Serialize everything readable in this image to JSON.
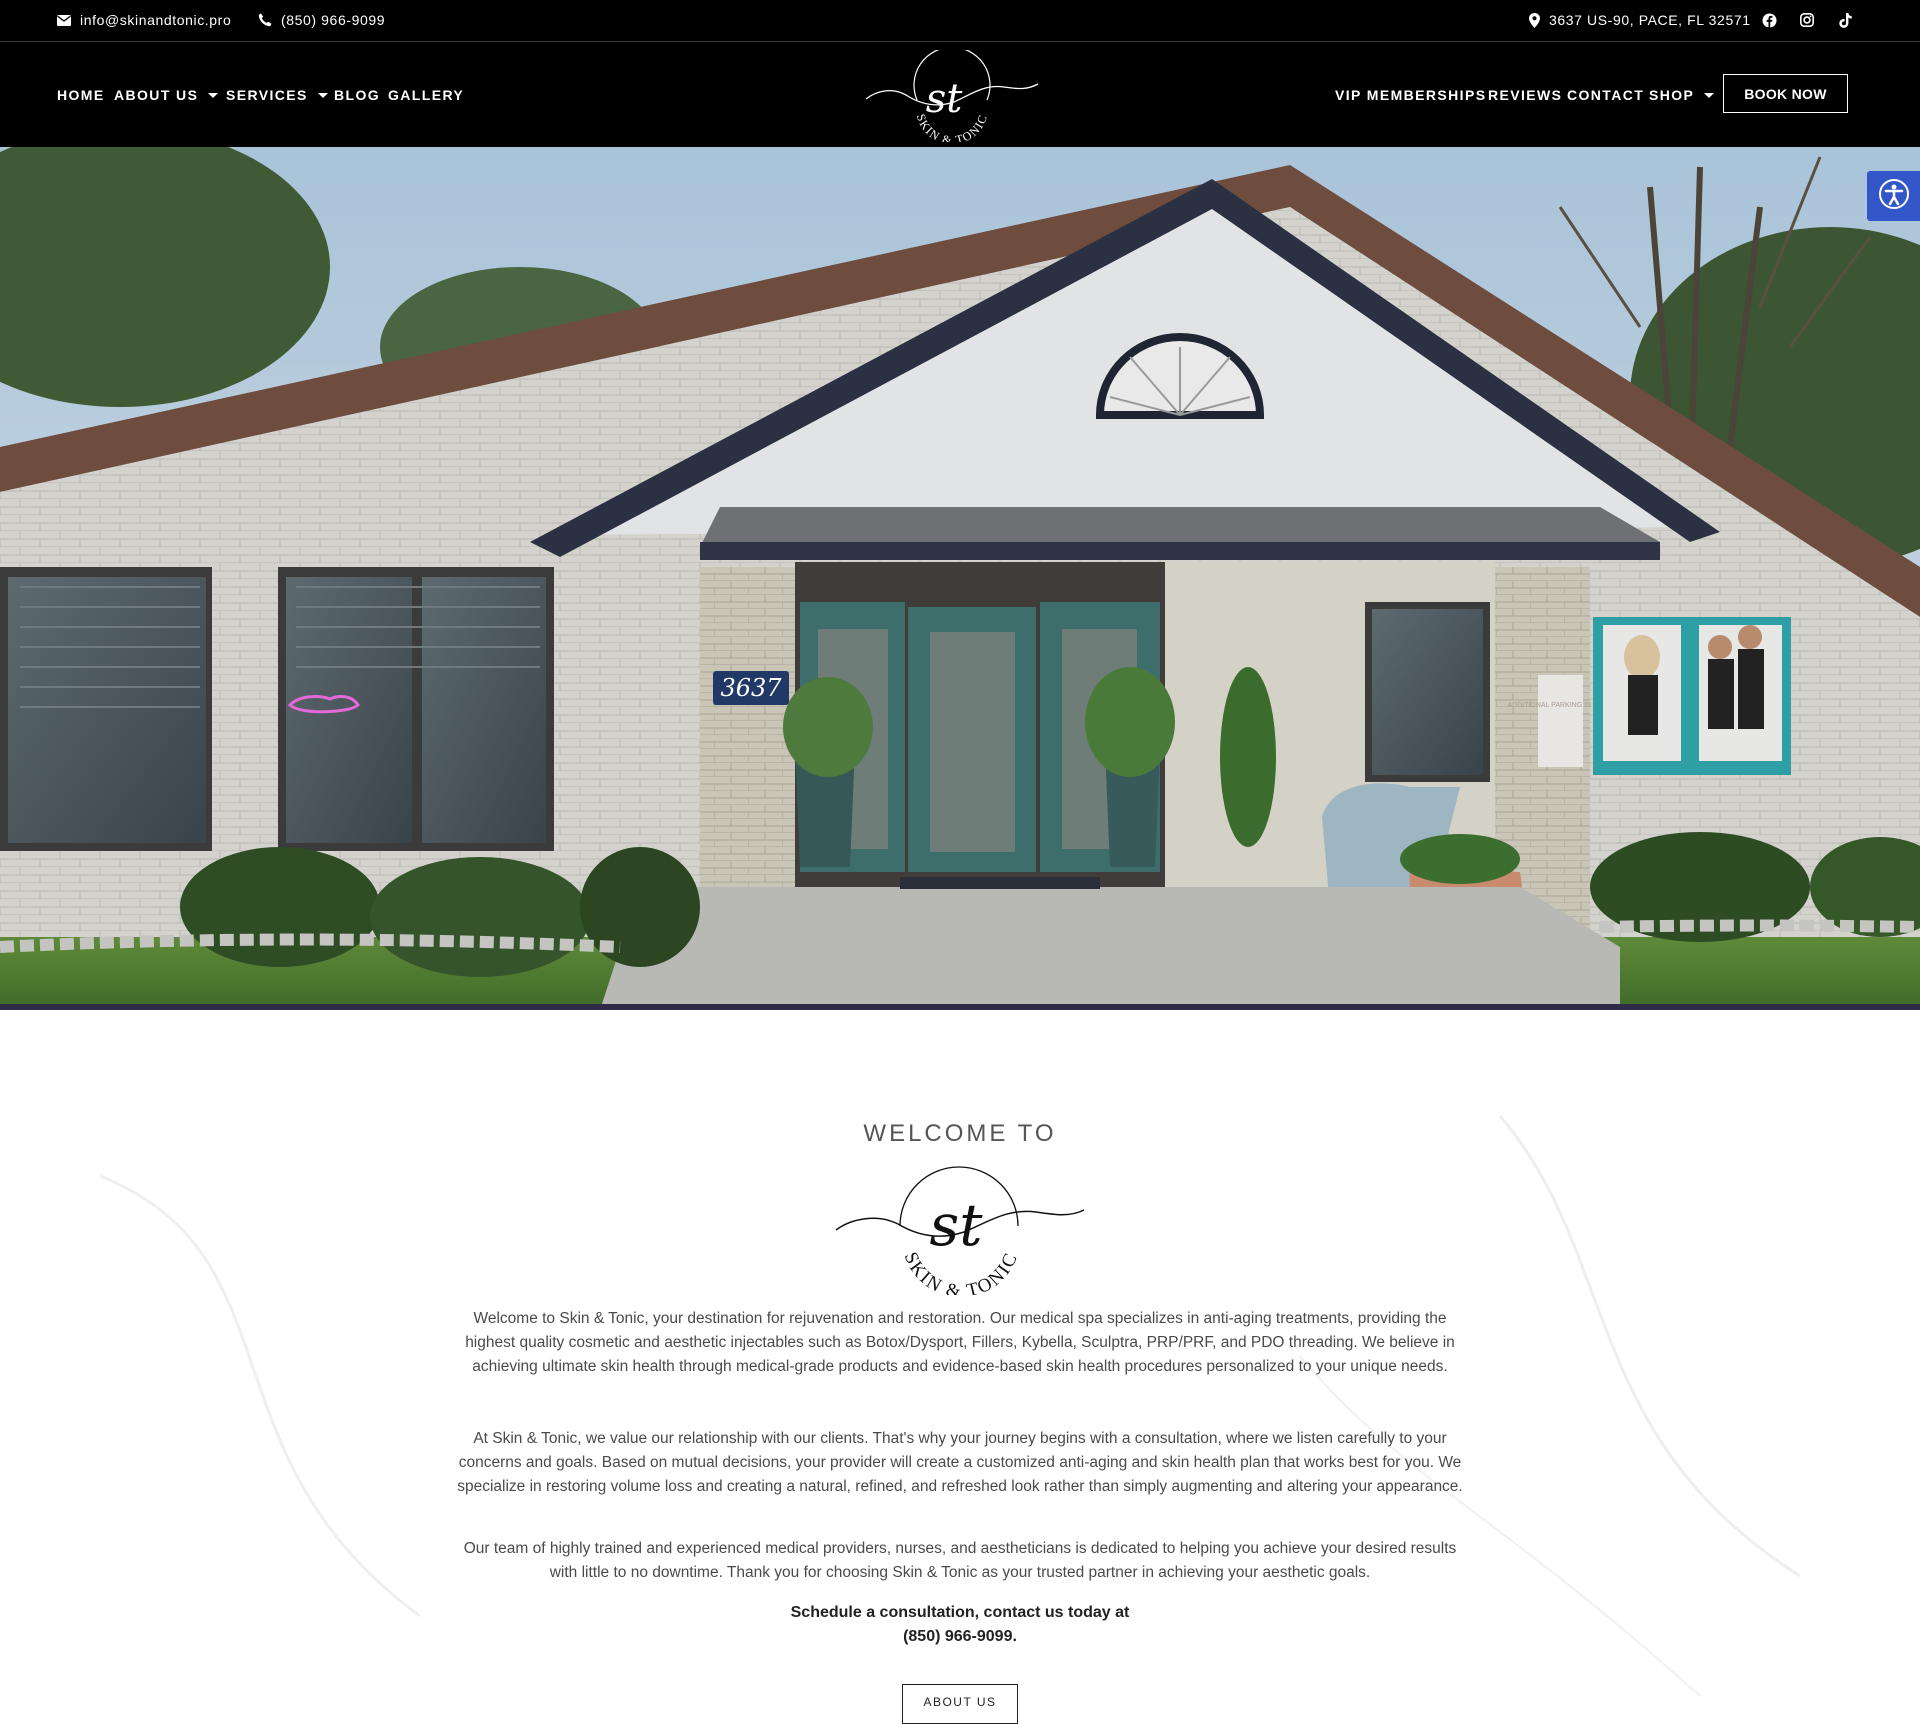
{
  "topbar": {
    "email": "info@skinandtonic.pro",
    "phone": "(850) 966-9099",
    "address": "3637 US-90, PACE, FL 32571"
  },
  "nav": {
    "left": [
      {
        "label": "HOME"
      },
      {
        "label": "ABOUT US"
      },
      {
        "label": "SERVICES"
      },
      {
        "label": "BLOG"
      },
      {
        "label": "GALLERY"
      }
    ],
    "right": [
      {
        "label": "VIP MEMBERSHIPS"
      },
      {
        "label": "REVIEWS"
      },
      {
        "label": "CONTACT"
      },
      {
        "label": "SHOP"
      }
    ],
    "book_label": "BOOK NOW"
  },
  "logo": {
    "monogram": "st",
    "wordmark": "SKIN & TONIC"
  },
  "hero": {
    "house_number": "3637",
    "sign_text": "ADDITIONAL PARKING IN REAR"
  },
  "welcome": {
    "title": "WELCOME TO",
    "paragraphs": [
      "Welcome to Skin & Tonic, your destination for rejuvenation and restoration. Our medical spa specializes in anti-aging treatments, providing the highest quality cosmetic and aesthetic injectables such as Botox/Dysport, Fillers, Kybella, Sculptra, PRP/PRF, and PDO threading. We believe in achieving ultimate skin health through medical-grade products and evidence-based skin health procedures personalized to your unique needs.",
      "At Skin & Tonic, we value our relationship with our clients. That's why your journey begins with a consultation, where we listen carefully to your concerns and goals. Based on mutual decisions, your provider will create a customized anti-aging and skin health plan that works best for you. We specialize in restoring volume loss and creating a natural, refined, and refreshed look rather than simply augmenting and altering your appearance.",
      "Our team of highly trained and experienced medical providers, nurses, and aestheticians is dedicated to helping you achieve your desired results with little to no downtime. Thank you for choosing Skin & Tonic as your trusted partner in achieving your aesthetic goals."
    ],
    "cta_line1": "Schedule a consultation, contact us today at",
    "cta_line2": "(850) 966-9099.",
    "about_button": "ABOUT US"
  },
  "colors": {
    "header_bg": "#000000",
    "accessibility_blue": "#3356c9",
    "body_text": "#4a4a4a"
  },
  "icons": [
    "envelope-icon",
    "phone-icon",
    "map-marker-icon",
    "facebook-icon",
    "instagram-icon",
    "tiktok-icon",
    "accessibility-icon",
    "caret-down-icon"
  ]
}
